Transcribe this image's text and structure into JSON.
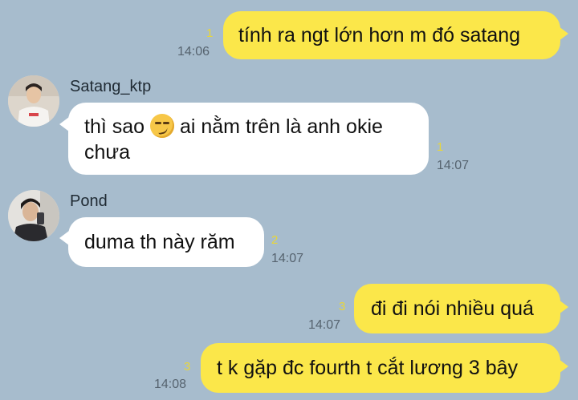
{
  "messages": [
    {
      "sender": "me",
      "text": "tính ra ngt lớn hơn m đó satang",
      "unread": "1",
      "time": "14:06"
    },
    {
      "sender": "Satang_ktp",
      "text_a": "thì sao",
      "emoji": "smirking-face",
      "text_b": "ai nằm trên là anh okie",
      "text_line2": "chưa",
      "unread": "1",
      "time": "14:07"
    },
    {
      "sender": "Pond",
      "text": "duma th này răm",
      "unread": "2",
      "time": "14:07"
    },
    {
      "sender": "me",
      "text": "đi đi nói nhiều quá",
      "unread": "3",
      "time": "14:07"
    },
    {
      "sender": "me",
      "text": "t k gặp đc fourth t cắt lương 3 bây",
      "unread": "3",
      "time": "14:08"
    }
  ],
  "colors": {
    "background": "#a7bccd",
    "outgoing": "#fbe74a",
    "incoming": "#ffffff",
    "unread": "#e8d63a"
  }
}
